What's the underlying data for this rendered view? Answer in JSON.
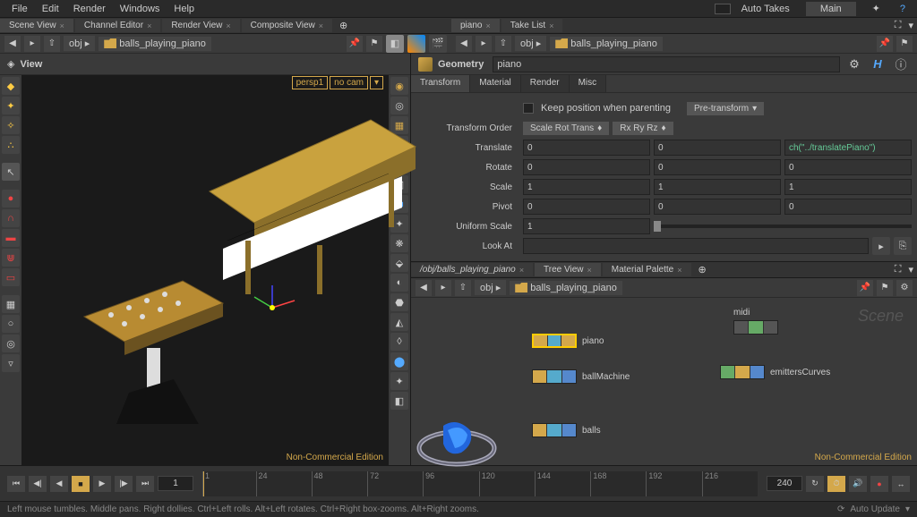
{
  "menu": {
    "file": "File",
    "edit": "Edit",
    "render": "Render",
    "windows": "Windows",
    "help": "Help",
    "autotakes": "Auto Takes",
    "main": "Main"
  },
  "leftTabs": {
    "scene": "Scene View",
    "channel": "Channel Editor",
    "renderv": "Render View",
    "composite": "Composite View"
  },
  "rightTabs": {
    "piano": "piano",
    "takelist": "Take List"
  },
  "path": {
    "obj": "obj",
    "scene": "balls_playing_piano"
  },
  "viewLabel": "View",
  "persp": {
    "cam": "persp1",
    "nocam": "no cam"
  },
  "ncEdition": "Non-Commercial Edition",
  "geom": {
    "title": "Geometry",
    "name": "piano"
  },
  "ptabs": {
    "transform": "Transform",
    "material": "Material",
    "render": "Render",
    "misc": "Misc"
  },
  "params": {
    "keepPos": "Keep position when parenting",
    "pretransform": "Pre-transform",
    "torder": "Transform Order",
    "torderVal": "Scale Rot Trans",
    "rorderVal": "Rx Ry Rz",
    "translate": "Translate",
    "tx": "0",
    "ty": "0",
    "tz": "ch(\"../translatePiano\")",
    "rotate": "Rotate",
    "rx": "0",
    "ry": "0",
    "rz": "0",
    "scale": "Scale",
    "sx": "1",
    "sy": "1",
    "sz": "1",
    "pivot": "Pivot",
    "px": "0",
    "py": "0",
    "pz": "0",
    "uscale": "Uniform Scale",
    "us": "1",
    "lookat": "Look At"
  },
  "netTabs": {
    "path": "/obj/balls_playing_piano",
    "tree": "Tree View",
    "matpal": "Material Palette"
  },
  "nodes": {
    "piano": "piano",
    "ball": "ballMachine",
    "balls": "balls",
    "midi": "midi",
    "emit": "emittersCurves"
  },
  "sceneLabel": "Scene",
  "timeline": {
    "start": "1",
    "cur": "1",
    "t24": "24",
    "t48": "48",
    "t72": "72",
    "t96": "96",
    "t120": "120",
    "t144": "144",
    "t168": "168",
    "t192": "192",
    "t216": "216",
    "end": "240"
  },
  "status": {
    "help": "Left mouse tumbles. Middle pans. Right dollies. Ctrl+Left rolls. Alt+Left rotates. Ctrl+Right box-zooms. Alt+Right zooms.",
    "auto": "Auto Update"
  }
}
